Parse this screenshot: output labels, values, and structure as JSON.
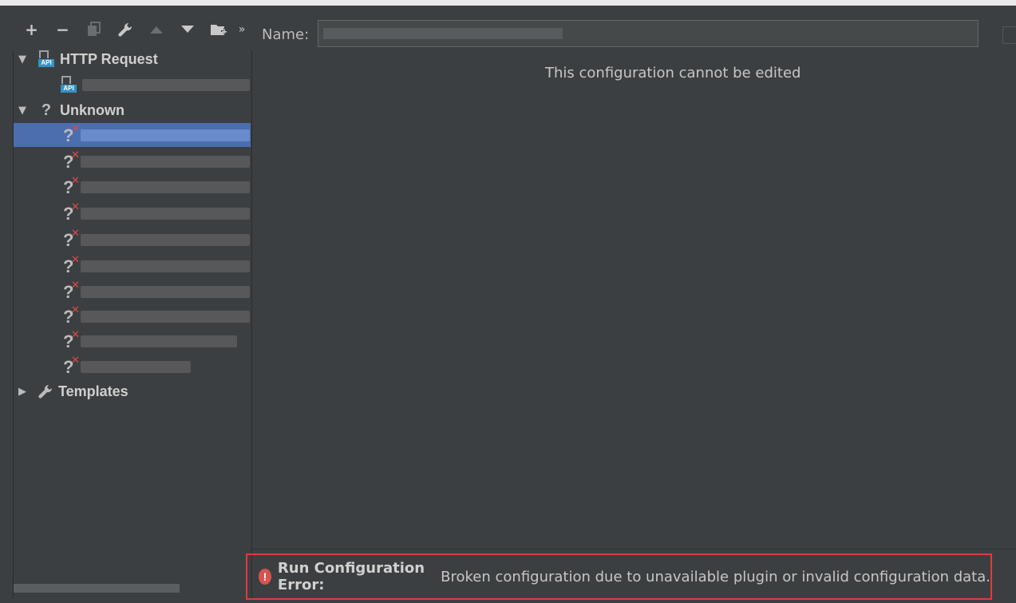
{
  "toolbar": {
    "add": "+",
    "remove": "−",
    "more": "»"
  },
  "tree": {
    "groups": [
      {
        "label": "HTTP Request",
        "icon_text": "API"
      },
      {
        "label": "Unknown"
      },
      {
        "label": "Templates"
      }
    ]
  },
  "editor": {
    "name_label": "Name:",
    "message": "This configuration cannot be edited"
  },
  "error": {
    "icon": "!",
    "title": "Run Configuration Error:",
    "text": "Broken configuration due to unavailable plugin or invalid configuration data."
  },
  "colors": {
    "background": "#3c3f41",
    "selection": "#4b6eaf",
    "error_border": "#e03b3b",
    "error_badge": "#e0474b"
  }
}
